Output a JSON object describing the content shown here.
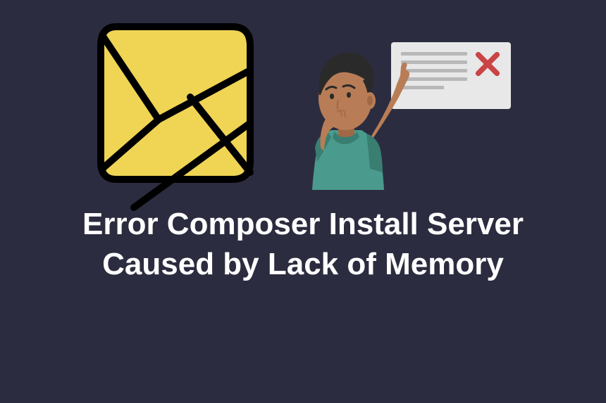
{
  "title": "Error Composer Install Server Caused by Lack of Memory",
  "colors": {
    "background": "#2c2c40",
    "logo_fill": "#f0d454",
    "error_x": "#c94444",
    "dialog_bg": "#e8e8e8",
    "skin": "#b87d56",
    "skin_shadow": "#a06845",
    "shirt": "#4a9b8e",
    "shirt_shadow": "#3a7e72",
    "hair": "#2a2a2a"
  }
}
